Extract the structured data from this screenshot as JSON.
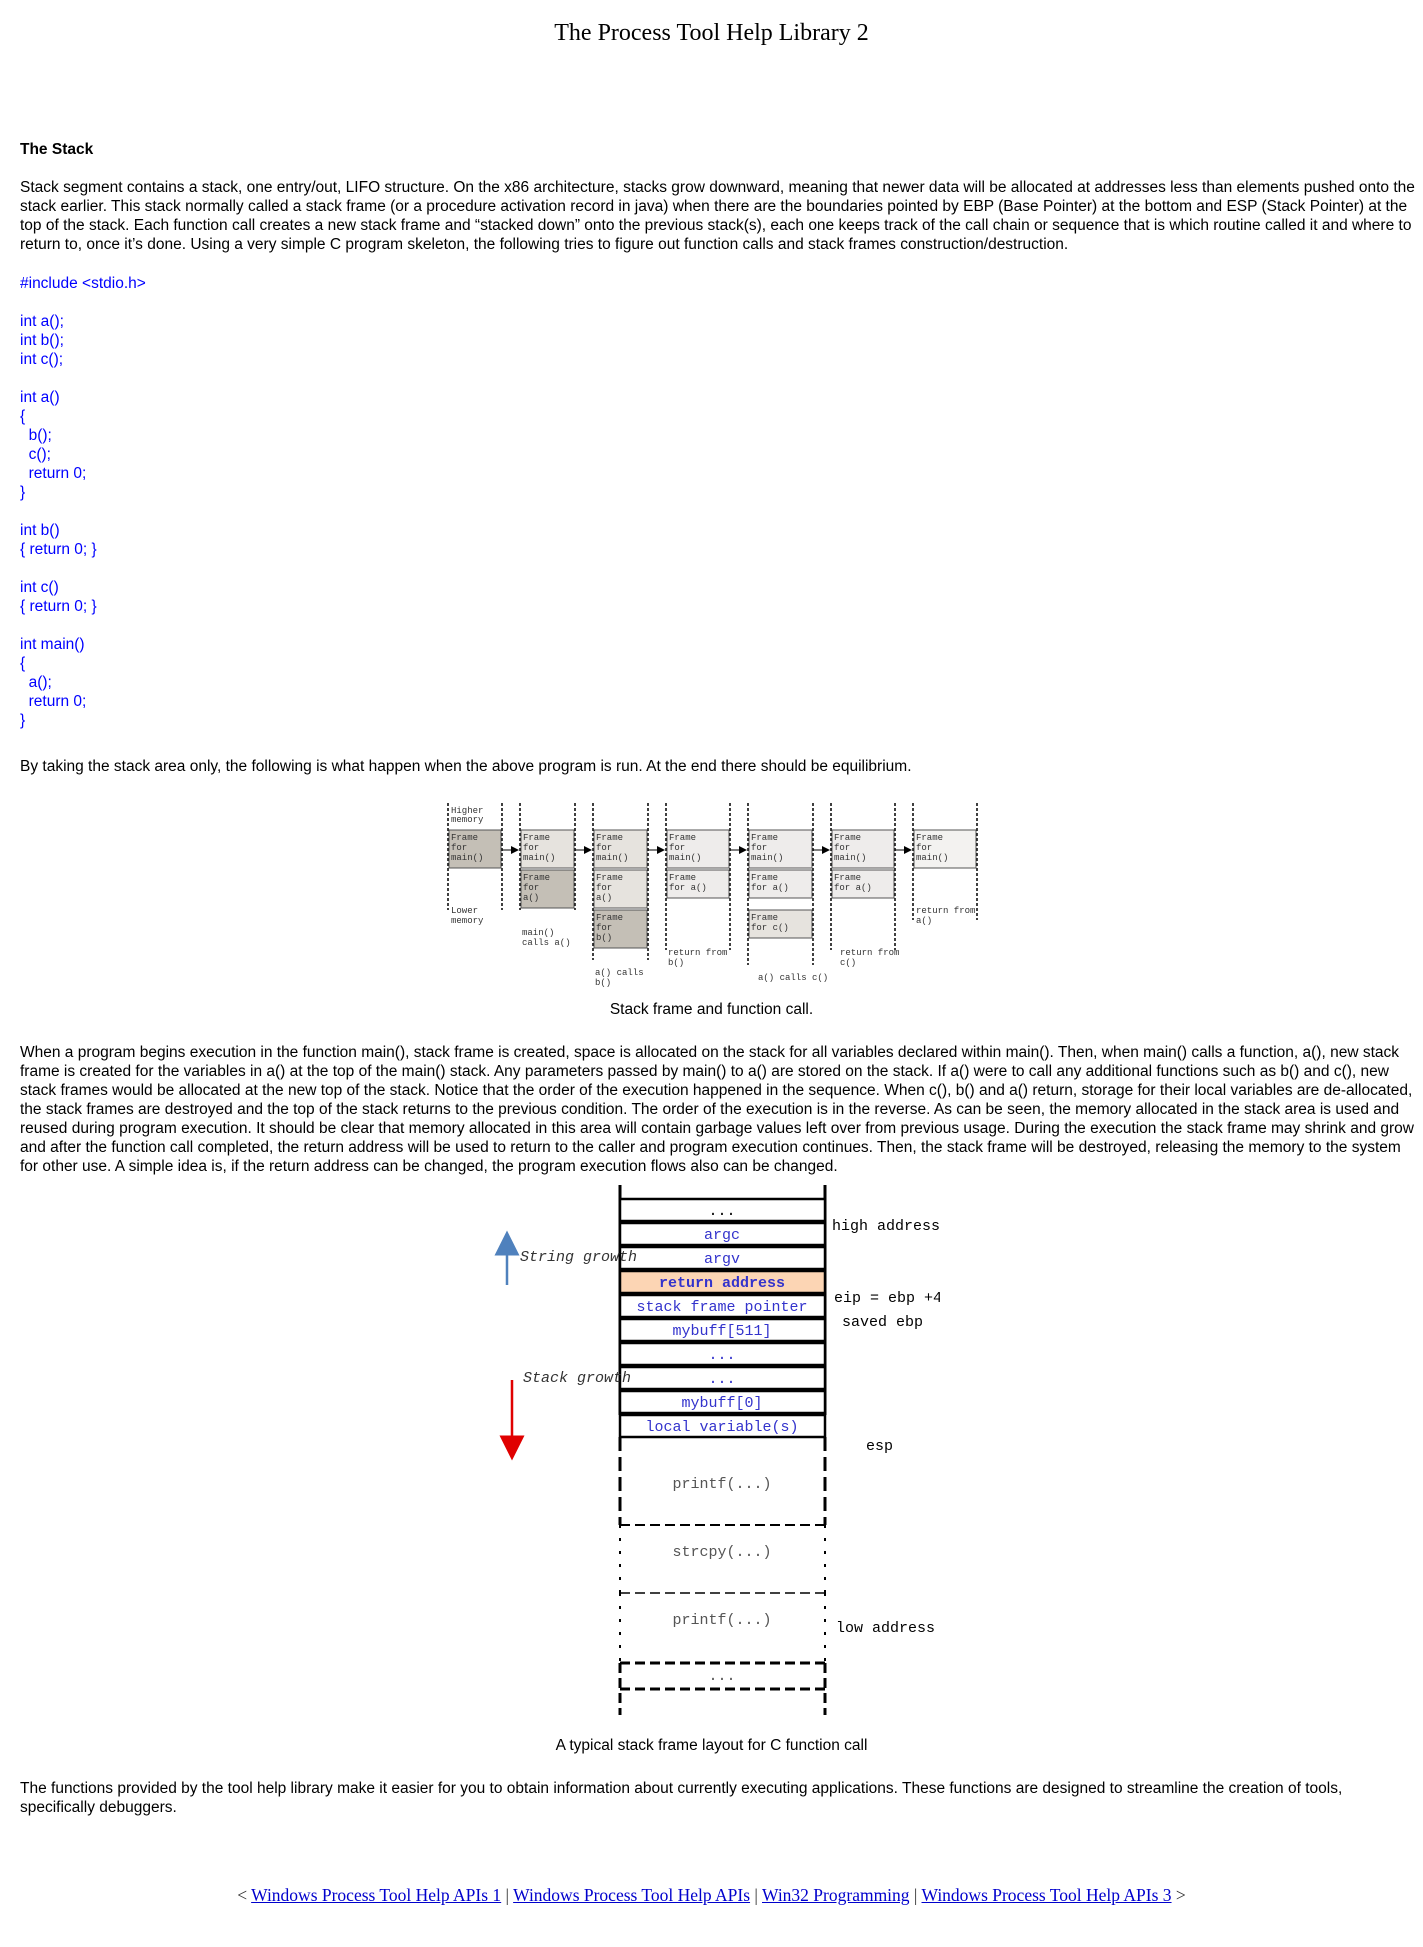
{
  "page_title": "The Process Tool Help Library 2",
  "section_heading": "The Stack",
  "intro_paragraph": "Stack segment contains a stack, one entry/out, LIFO structure.  On the x86 architecture, stacks grow downward, meaning that newer data will be allocated at addresses less than elements pushed onto the stack earlier. This stack normally called a stack frame (or a procedure activation record in java) when there are the boundaries pointed by EBP (Base Pointer) at the bottom and ESP (Stack Pointer) at the top of the stack.  Each function call creates a new stack frame and “stacked down” onto the previous stack(s), each one keeps track of the call chain or sequence that is which routine called it and where to return to, once it’s done.  Using a very simple C program skeleton, the following tries to figure out function calls and stack frames construction/destruction.",
  "code_lines": [
    "#include <stdio.h>",
    "",
    "int a();",
    "int b();",
    "int c();",
    "",
    "int a()",
    "{",
    "  b();",
    "  c();",
    "  return 0;",
    "}",
    "",
    "int b()",
    "{ return 0; }",
    "",
    "int c()",
    "{ return 0; }",
    "",
    "int main()",
    "{",
    "  a();",
    "  return 0;",
    "}"
  ],
  "paragraph_2": "By taking the stack area only, the following is what happen when the above program is run.  At the end there should be equilibrium.",
  "figure1": {
    "caption": "Stack frame and function call.",
    "higher_memory": [
      "Higher",
      "memory"
    ],
    "lower_memory": [
      "Lower",
      "memory"
    ],
    "frame_for_main": [
      "Frame",
      "for",
      "main()"
    ],
    "frame_for_a_3": [
      "Frame",
      "for",
      "a()"
    ],
    "frame_for_a_2": [
      "Frame",
      "for a()"
    ],
    "frame_for_b": [
      "Frame",
      "for",
      "b()"
    ],
    "frame_for_c": [
      "Frame",
      "for c()"
    ],
    "note_main_calls_a": [
      "main()",
      "calls a()"
    ],
    "note_a_calls_b": [
      "a() calls",
      "b()"
    ],
    "note_return_from_b": [
      "return from",
      "b()"
    ],
    "note_a_calls_c": [
      "a() calls c()"
    ],
    "note_return_from_c": [
      "return from",
      "c()"
    ],
    "note_return_from_a": [
      "return from",
      "a()"
    ]
  },
  "paragraph_3": "When a program begins execution in the function main(), stack frame is created, space is allocated on the stack for all variables declared within main().  Then, when main() calls a function, a(), new stack frame is created for the variables in a() at the top of the main() stack.  Any parameters passed by main() to a() are stored on the stack.  If a() were to call any additional functions such as b() and c(), new stack frames would be allocated at the new top of the stack.  Notice that the order of the execution happened in the sequence.  When c(), b() and a() return, storage for their local variables are de-allocated, the stack frames are destroyed and the top of the stack returns to the previous condition.  The order of the execution is in the reverse.  As can be seen, the memory allocated in the stack area is used and reused during program execution.  It should be clear that memory allocated in this area will contain garbage values left over from previous usage.  During the execution the stack frame may shrink and grow and after the function call completed, the return address will be used to return to the caller and program execution continues. Then, the stack frame will be destroyed, releasing the memory to the system for other use. A simple idea is, if the return address can be changed, the program execution flows also can be changed.",
  "figure2": {
    "caption": "A typical stack frame layout for C function call",
    "cells": [
      "...",
      "argc",
      "argv",
      "return address",
      "stack frame pointer",
      "mybuff[511]",
      "...",
      "...",
      "mybuff[0]",
      "local variable(s)"
    ],
    "lower_cells": [
      "printf(...)",
      "strcpy(...)",
      "printf(...)",
      "..."
    ],
    "label_high_address": "high address",
    "label_eip": "eip = ebp +4",
    "label_saved_ebp": "saved ebp",
    "label_esp": "esp",
    "label_low_address": "low address",
    "label_string_growth": "String growth",
    "label_stack_growth": "Stack growth",
    "colors": {
      "highlight": "#fcd5b4",
      "code_blue": "#3333cc",
      "up_arrow": "#4f81bd",
      "down_arrow": "#e00000"
    }
  },
  "paragraph_4": "The functions provided by the tool help library make it easier for you to obtain information about currently executing applications. These functions are designed to streamline the creation of tools, specifically debuggers.",
  "nav": {
    "open": "<",
    "close": ">",
    "separator": "|",
    "links": [
      "Windows Process Tool Help APIs 1",
      "Windows Process Tool Help APIs",
      "Win32 Programming",
      "Windows Process Tool Help APIs 3"
    ]
  }
}
